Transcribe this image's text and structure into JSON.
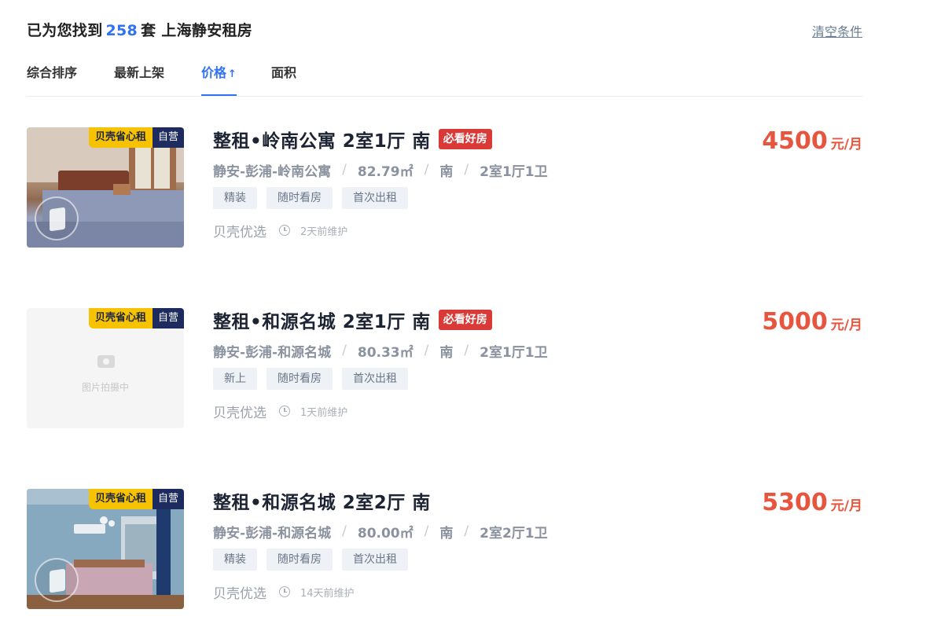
{
  "header": {
    "prefix": "已为您找到",
    "count": "258",
    "suffix": "套 上海静安租房",
    "clear_label": "清空条件"
  },
  "sort_tabs": [
    {
      "label": "综合排序"
    },
    {
      "label": "最新上架"
    },
    {
      "label": "价格",
      "arrow": "↑",
      "active": true
    },
    {
      "label": "面积"
    }
  ],
  "badges": {
    "sxz": "贝壳省心租",
    "zy": "自营"
  },
  "listings": [
    {
      "title": "整租•岭南公寓 2室1厅 南",
      "must_see": "必看好房",
      "community": "静安-彭浦-岭南公寓",
      "area": "82.79㎡",
      "orientation": "南",
      "layout": "2室1厅1卫",
      "tags": [
        "精装",
        "随时看房",
        "首次出租"
      ],
      "brand": "贝壳优选",
      "maintained": "2天前维护",
      "price": "4500",
      "price_unit": "元/月",
      "image": "photo-bedroom-wood"
    },
    {
      "title": "整租•和源名城 2室1厅 南",
      "must_see": "必看好房",
      "community": "静安-彭浦-和源名城",
      "area": "80.33㎡",
      "orientation": "南",
      "layout": "2室1厅1卫",
      "tags": [
        "新上",
        "随时看房",
        "首次出租"
      ],
      "brand": "贝壳优选",
      "maintained": "1天前维护",
      "price": "5000",
      "price_unit": "元/月",
      "image": "placeholder",
      "placeholder_text": "图片拍摄中"
    },
    {
      "title": "整租•和源名城 2室2厅 南",
      "must_see": "",
      "community": "静安-彭浦-和源名城",
      "area": "80.00㎡",
      "orientation": "南",
      "layout": "2室2厅1卫",
      "tags": [
        "精装",
        "随时看房",
        "首次出租"
      ],
      "brand": "贝壳优选",
      "maintained": "14天前维护",
      "price": "5300",
      "price_unit": "元/月",
      "image": "photo-bedroom-blue"
    }
  ],
  "colors": {
    "accent": "#3072f6",
    "price": "#e8553e",
    "must_see": "#d93a37"
  }
}
